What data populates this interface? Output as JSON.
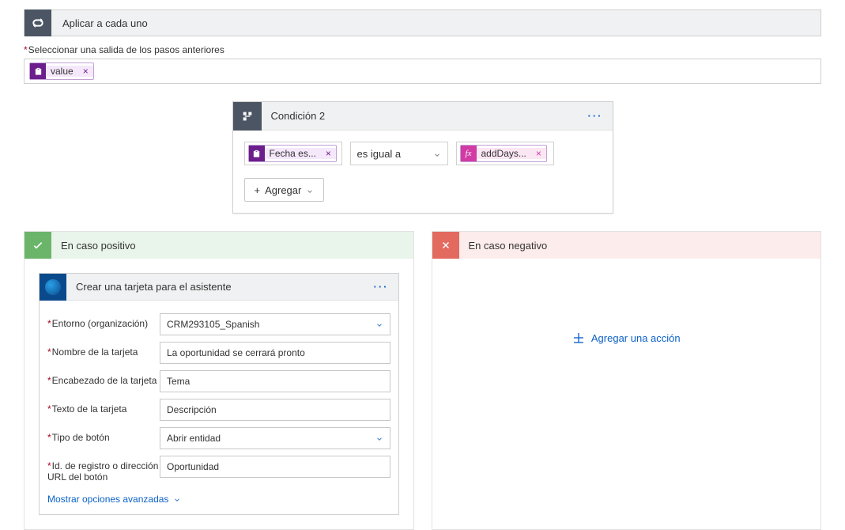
{
  "foreach": {
    "title": "Aplicar a cada uno",
    "fieldLabel": "Seleccionar una salida de los pasos anteriores",
    "token": {
      "icon": "📋",
      "label": "value",
      "remove": "×"
    }
  },
  "condition": {
    "title": "Condición 2",
    "left": {
      "label": "Fecha es...",
      "remove": "×"
    },
    "operator": "es igual a",
    "right": {
      "fx": "fx",
      "label": "addDays...",
      "remove": "×"
    },
    "addBtn": "Agregar"
  },
  "branches": {
    "positive": "En caso positivo",
    "negative": "En caso negativo",
    "addAction": "Agregar una acción"
  },
  "actionCard": {
    "title": "Crear una tarjeta para el asistente",
    "fields": {
      "envLabel": "Entorno (organización)",
      "envValue": "CRM293105_Spanish",
      "cardNameLabel": "Nombre de la tarjeta",
      "cardNameValue": "La oportunidad se cerrará pronto",
      "headerLabel": "Encabezado de la tarjeta",
      "headerValue": "Tema",
      "textLabel": "Texto de la tarjeta",
      "textValue": "Descripción",
      "buttonTypeLabel": "Tipo de botón",
      "buttonTypeValue": "Abrir entidad",
      "recordIdLabel": "Id. de registro o dirección URL del botón",
      "recordIdValue": "Oportunidad"
    },
    "advanced": "Mostrar opciones avanzadas"
  }
}
